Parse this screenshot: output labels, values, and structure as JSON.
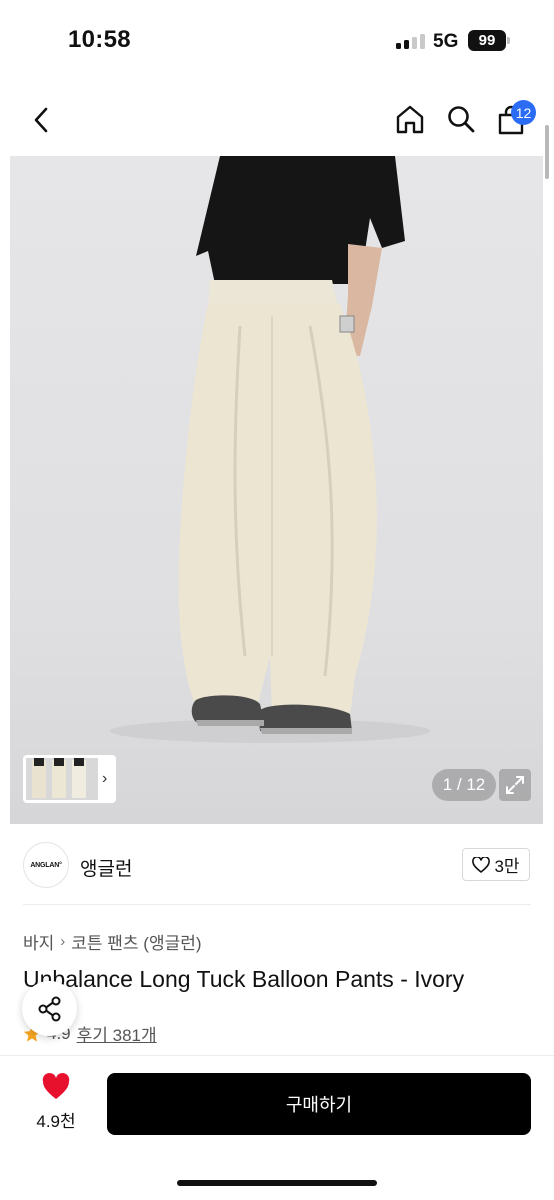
{
  "status_bar": {
    "time": "10:58",
    "network": "5G",
    "battery": "99"
  },
  "nav": {
    "back_icon": "chevron-left-icon",
    "home_icon": "home-icon",
    "search_icon": "search-icon",
    "cart_icon": "shopping-bag-icon",
    "cart_count": "12",
    "badge_color": "#2a6df4"
  },
  "gallery": {
    "counter": "1 / 12",
    "expand_icon": "expand-icon",
    "thumbnail_chevron": "chevron-right-icon"
  },
  "brand": {
    "logo_text": "ANGLAN°",
    "name": "앵글런",
    "like_count": "3만"
  },
  "breadcrumb": {
    "items": [
      "바지",
      "코튼 팬츠 (앵글런)"
    ]
  },
  "product": {
    "title": "Unbalance Long Tuck Balloon Pants - Ivory",
    "rating": "4.9",
    "reviews": "후기 381개",
    "star_color": "#f6a623"
  },
  "bottom": {
    "wish_count": "4.9천",
    "heart_color": "#e8112d",
    "buy_label": "구매하기"
  }
}
